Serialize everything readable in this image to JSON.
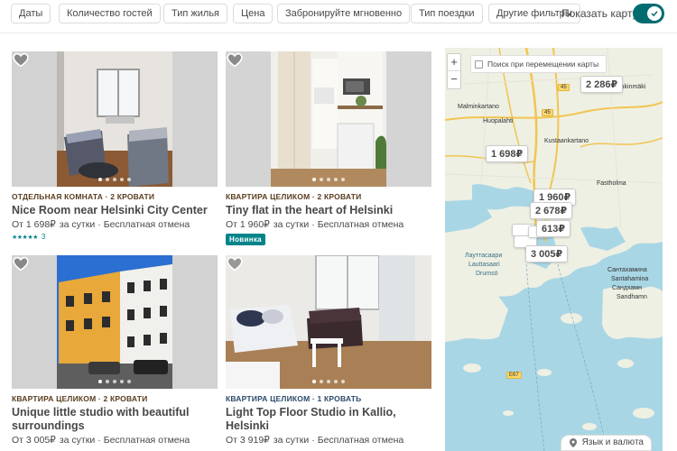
{
  "filters": {
    "chips": [
      "Даты",
      "Количество гостей",
      "Тип жилья",
      "Цена",
      "Забронируйте мгновенно",
      "Тип поездки",
      "Другие фильтры"
    ],
    "show_map_label": "Показать карту"
  },
  "listings": [
    {
      "kicker": "Отдельная комната · 2 кровати",
      "title": "Nice Room near Helsinki City Center",
      "price_prefix": "От 1 698₽",
      "price_period": "за сутки",
      "cancellation": "Бесплатная отмена",
      "rating_count": "3",
      "rating_stars": 5
    },
    {
      "kicker": "Квартира целиком · 2 кровати",
      "title": "Tiny flat in the heart of Helsinki",
      "price_prefix": "От 1 960₽",
      "price_period": "за сутки",
      "cancellation": "Бесплатная отмена",
      "badge": "Новинка"
    },
    {
      "kicker": "Квартира целиком · 2 кровати",
      "title": "Unique little studio with beautiful surroundings",
      "price_prefix": "От 3 005₽",
      "price_period": "за сутки",
      "cancellation": "Бесплатная отмена"
    },
    {
      "kicker": "Квартира целиком · 1 кровать",
      "title": "Light Top Floor Studio in Kallio, Helsinki",
      "price_prefix": "От 3 919₽",
      "price_period": "за сутки",
      "cancellation": "Бесплатная отмена"
    }
  ],
  "map": {
    "search_on_move": "Поиск при перемещении карты",
    "zoom_in": "+",
    "zoom_out": "−",
    "price_pins": [
      "2 286₽",
      "1 698₽",
      "1 960₽",
      "2 678₽",
      "613₽",
      "3 005₽"
    ],
    "labels": [
      "Malminkartano",
      "Huopalahti",
      "Kustaankartano",
      "Pukinmäki",
      "Fastholma",
      "Лауттасаари",
      "Lauttasaari",
      "Drumsö",
      "Сантахамина",
      "Santahamina",
      "Сандхамн",
      "Sandhamn"
    ],
    "road_numbers": [
      "45",
      "45",
      "E67"
    ],
    "language_button": "Язык и валюта"
  },
  "colors": {
    "accent": "#006c70",
    "teal": "#00848a",
    "water": "#a9d6e5",
    "land": "#eef0e3"
  }
}
